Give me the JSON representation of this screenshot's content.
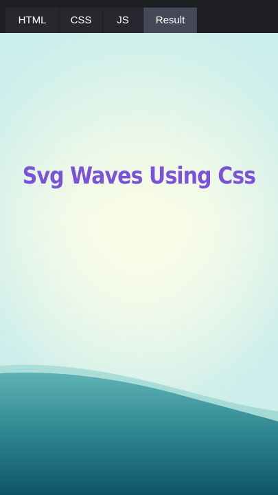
{
  "tabs": [
    {
      "label": "HTML"
    },
    {
      "label": "CSS"
    },
    {
      "label": "JS"
    },
    {
      "label": "Result"
    }
  ],
  "active_tab": "Result",
  "result": {
    "title": "Svg Waves Using Css"
  },
  "colors": {
    "title": "#7b52d8",
    "wave_light": "#7ec6c6",
    "wave_dark": "#0f5b6c",
    "tab_active": "#444857",
    "tab_inactive": "#27282e"
  }
}
